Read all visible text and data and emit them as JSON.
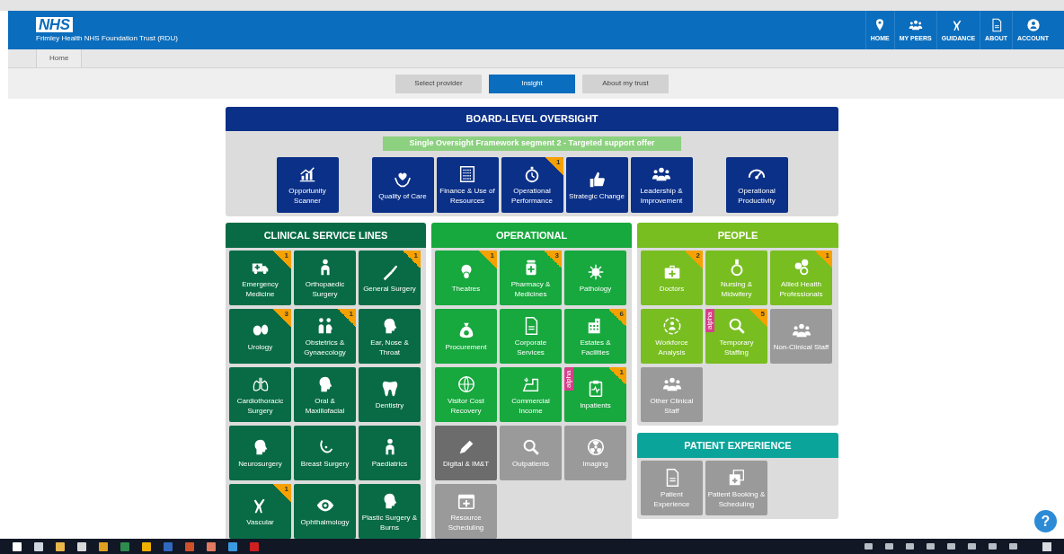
{
  "header": {
    "logo": "NHS",
    "trust": "Frimley Health NHS Foundation Trust (RDU)",
    "nav": [
      {
        "label": "HOME"
      },
      {
        "label": "MY PEERS"
      },
      {
        "label": "GUIDANCE"
      },
      {
        "label": "ABOUT"
      },
      {
        "label": "ACCOUNT"
      }
    ]
  },
  "breadcrumb": [
    "Home"
  ],
  "tabs": [
    {
      "label": "Select provider",
      "selected": false
    },
    {
      "label": "Insight",
      "selected": true
    },
    {
      "label": "About my trust",
      "selected": false
    }
  ],
  "board": {
    "title": "BOARD-LEVEL OVERSIGHT",
    "color": "#0b3088",
    "banner": "Single Oversight Framework segment 2 - Targeted support offer",
    "tiles": [
      {
        "label": "Opportunity Scanner",
        "disabled": false,
        "hovered": false
      },
      {
        "label": "Quality of Care",
        "disabled": false,
        "hovered": false
      },
      {
        "label": "Finance & Use of Resources",
        "disabled": false,
        "hovered": false
      },
      {
        "label": "Operational Performance",
        "disabled": false,
        "hovered": false,
        "badge": "1"
      },
      {
        "label": "Strategic Change",
        "disabled": false,
        "hovered": false
      },
      {
        "label": "Leadership & Improvement",
        "disabled": false,
        "hovered": false
      },
      {
        "label": "Operational Productivity",
        "disabled": false,
        "hovered": false
      }
    ]
  },
  "sections": [
    {
      "title": "CLINICAL SERVICE LINES",
      "color": "#086b45",
      "tiles": [
        {
          "label": "Emergency Medicine",
          "disabled": false,
          "hovered": false,
          "badge": "1"
        },
        {
          "label": "Orthopaedic Surgery",
          "disabled": false,
          "hovered": false
        },
        {
          "label": "General Surgery",
          "disabled": false,
          "hovered": false,
          "badge": "1"
        },
        {
          "label": "Urology",
          "disabled": false,
          "hovered": false,
          "badge": "3"
        },
        {
          "label": "Obstetrics & Gynaecology",
          "disabled": false,
          "hovered": false,
          "badge": "1"
        },
        {
          "label": "Ear, Nose & Throat",
          "disabled": false,
          "hovered": false
        },
        {
          "label": "Cardiothoracic Surgery",
          "disabled": false,
          "hovered": false
        },
        {
          "label": "Oral & Maxillofacial",
          "disabled": false,
          "hovered": false
        },
        {
          "label": "Dentistry",
          "disabled": false,
          "hovered": false
        },
        {
          "label": "Neurosurgery",
          "disabled": false,
          "hovered": false
        },
        {
          "label": "Breast Surgery",
          "disabled": false,
          "hovered": false
        },
        {
          "label": "Paediatrics",
          "disabled": false,
          "hovered": false
        },
        {
          "label": "Vascular",
          "disabled": false,
          "hovered": false,
          "badge": "1"
        },
        {
          "label": "Ophthalmology",
          "disabled": false,
          "hovered": false
        },
        {
          "label": "Plastic Surgery & Burns",
          "disabled": false,
          "hovered": false
        }
      ]
    },
    {
      "title": "OPERATIONAL",
      "color": "#17a83e",
      "tiles": [
        {
          "label": "Theatres",
          "disabled": false,
          "hovered": false,
          "badge": "1"
        },
        {
          "label": "Pharmacy & Medicines",
          "disabled": false,
          "hovered": false,
          "badge": "3"
        },
        {
          "label": "Pathology",
          "disabled": false,
          "hovered": false
        },
        {
          "label": "Procurement",
          "disabled": false,
          "hovered": false
        },
        {
          "label": "Corporate Services",
          "disabled": false,
          "hovered": false
        },
        {
          "label": "Estates & Facilities",
          "disabled": false,
          "hovered": false,
          "badge": "6"
        },
        {
          "label": "Visitor Cost Recovery",
          "disabled": false,
          "hovered": false
        },
        {
          "label": "Commercial Income",
          "disabled": false,
          "hovered": false
        },
        {
          "label": "Inpatients",
          "disabled": false,
          "hovered": false,
          "badge": "1",
          "tag": "alpha"
        },
        {
          "label": "Digital & IM&T",
          "disabled": true,
          "hovered": true
        },
        {
          "label": "Outpatients",
          "disabled": true,
          "hovered": false
        },
        {
          "label": "Imaging",
          "disabled": true,
          "hovered": false
        },
        {
          "label": "Resource Scheduling",
          "disabled": true,
          "hovered": false
        }
      ]
    },
    {
      "title": "PEOPLE",
      "color": "#78be20",
      "tiles": [
        {
          "label": "Doctors",
          "disabled": false,
          "hovered": false,
          "badge": "2"
        },
        {
          "label": "Nursing & Midwifery",
          "disabled": false,
          "hovered": false
        },
        {
          "label": "Allied Health Professionals",
          "disabled": false,
          "hovered": false,
          "badge": "1"
        },
        {
          "label": "Workforce Analysis",
          "disabled": false,
          "hovered": false
        },
        {
          "label": "Temporary Staffing",
          "disabled": false,
          "hovered": false,
          "badge": "5",
          "tag": "alpha"
        },
        {
          "label": "Non-Clinical Staff",
          "disabled": true,
          "hovered": false
        },
        {
          "label": "Other Clinical Staff",
          "disabled": true,
          "hovered": false
        }
      ]
    },
    {
      "title": "PATIENT EXPERIENCE",
      "color": "#0aa49b",
      "tiles": [
        {
          "label": "Patient Experience",
          "disabled": true,
          "hovered": false
        },
        {
          "label": "Patient Booking & Scheduling",
          "disabled": true,
          "hovered": false
        }
      ]
    }
  ],
  "help_button": "?"
}
